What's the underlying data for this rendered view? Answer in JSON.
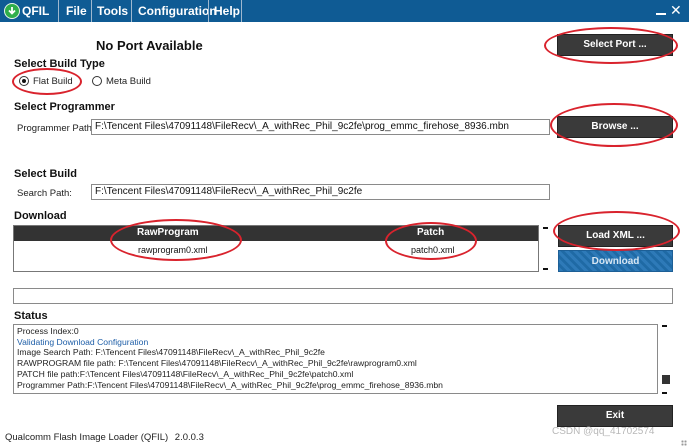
{
  "app": {
    "name": "QFIL"
  },
  "menu": [
    {
      "label": "File"
    },
    {
      "label": "Tools"
    },
    {
      "label": "Configuration"
    },
    {
      "label": "Help"
    }
  ],
  "window_controls": {
    "minimize": "",
    "close": "✕"
  },
  "port": {
    "status": "No Port Available",
    "select_port_label": "Select Port ..."
  },
  "build_type": {
    "title": "Select Build Type",
    "options": [
      {
        "label": "Flat Build",
        "checked": true
      },
      {
        "label": "Meta Build",
        "checked": false
      }
    ]
  },
  "programmer": {
    "title": "Select Programmer",
    "path_label": "Programmer Path",
    "path_value": "F:\\Tencent Files\\47091148\\FileRecv\\_A_withRec_Phil_9c2fe\\prog_emmc_firehose_8936.mbn",
    "browse_label": "Browse ..."
  },
  "build": {
    "title": "Select Build",
    "search_label": "Search Path:",
    "search_value": "F:\\Tencent Files\\47091148\\FileRecv\\_A_withRec_Phil_9c2fe"
  },
  "download": {
    "title": "Download",
    "columns": [
      "RawProgram",
      "Patch"
    ],
    "rows": [
      [
        "rawprogram0.xml",
        "patch0.xml"
      ]
    ],
    "load_xml_label": "Load XML ...",
    "download_label": "Download"
  },
  "status": {
    "title": "Status",
    "lines": [
      {
        "text": "Process Index:0",
        "link": false
      },
      {
        "text": "Validating Download Configuration",
        "link": true
      },
      {
        "text": "Image Search Path: F:\\Tencent Files\\47091148\\FileRecv\\_A_withRec_Phil_9c2fe",
        "link": false
      },
      {
        "text": "RAWPROGRAM file path: F:\\Tencent Files\\47091148\\FileRecv\\_A_withRec_Phil_9c2fe\\rawprogram0.xml",
        "link": false
      },
      {
        "text": "PATCH file path:F:\\Tencent Files\\47091148\\FileRecv\\_A_withRec_Phil_9c2fe\\patch0.xml",
        "link": false
      },
      {
        "text": "Programmer Path:F:\\Tencent Files\\47091148\\FileRecv\\_A_withRec_Phil_9c2fe\\prog_emmc_firehose_8936.mbn",
        "link": false
      }
    ]
  },
  "exit_label": "Exit",
  "footer": {
    "product": "Qualcomm Flash Image Loader (QFIL)",
    "version": "2.0.0.3",
    "watermark": "CSDN @qq_41702574"
  },
  "colors": {
    "titlebar": "#0f5b94",
    "annotation": "#d9232d",
    "dark_button": "#3a3a3a",
    "download_button": "#2e7ab8",
    "log_link": "#1f5fa8"
  }
}
